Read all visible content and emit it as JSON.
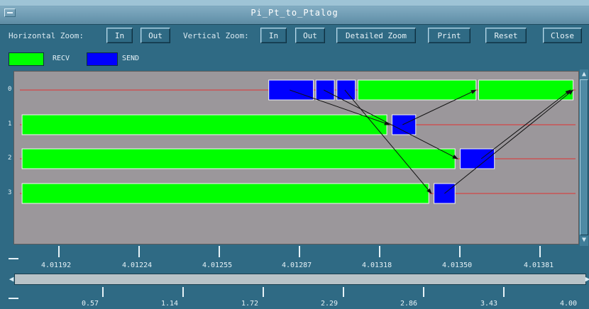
{
  "window": {
    "title": "Pi_Pt_to_Ptalog"
  },
  "toolbar": {
    "horizontal_zoom_label": "Horizontal Zoom:",
    "h_in": "In",
    "h_out": "Out",
    "vertical_zoom_label": "Vertical Zoom:",
    "v_in": "In",
    "v_out": "Out",
    "detailed_zoom": "Detailed Zoom",
    "print": "Print",
    "reset": "Reset",
    "close": "Close"
  },
  "legend": {
    "items": [
      {
        "label": "RECV",
        "color": "#00ff00"
      },
      {
        "label": "SEND",
        "color": "#0000ff"
      }
    ]
  },
  "colors": {
    "recv": "#00ff00",
    "send": "#0000ff",
    "timeline": "#e03030",
    "arrow": "#111111",
    "plot_bg": "#9b979b",
    "frame": "#2f6a84"
  },
  "chart_data": {
    "type": "timeline",
    "rows": [
      "0",
      "1",
      "2",
      "3"
    ],
    "x_unit": "time",
    "x_ticks": [
      "4.01192",
      "4.01224",
      "4.01255",
      "4.01287",
      "4.01318",
      "4.01350",
      "4.01381"
    ],
    "x_tick_values": [
      4.01192,
      4.01224,
      4.01255,
      4.01287,
      4.01318,
      4.0135,
      4.01381
    ],
    "xlim": [
      4.01172,
      4.01387
    ],
    "events": [
      {
        "row": 0,
        "kind": "SEND",
        "start": 4.01269,
        "end": 4.01286
      },
      {
        "row": 0,
        "kind": "SEND",
        "start": 4.01287,
        "end": 4.01294
      },
      {
        "row": 0,
        "kind": "SEND",
        "start": 4.01295,
        "end": 4.01302
      },
      {
        "row": 0,
        "kind": "RECV",
        "start": 4.01303,
        "end": 4.01348
      },
      {
        "row": 0,
        "kind": "RECV",
        "start": 4.01349,
        "end": 4.01385
      },
      {
        "row": 1,
        "kind": "RECV",
        "start": 4.01175,
        "end": 4.01314
      },
      {
        "row": 1,
        "kind": "SEND",
        "start": 4.01316,
        "end": 4.01325
      },
      {
        "row": 2,
        "kind": "RECV",
        "start": 4.01175,
        "end": 4.0134
      },
      {
        "row": 2,
        "kind": "SEND",
        "start": 4.01342,
        "end": 4.01355
      },
      {
        "row": 3,
        "kind": "RECV",
        "start": 4.01175,
        "end": 4.0133
      },
      {
        "row": 3,
        "kind": "SEND",
        "start": 4.01332,
        "end": 4.0134
      }
    ],
    "messages": [
      {
        "from_row": 0,
        "from_t": 4.01277,
        "to_row": 1,
        "to_t": 4.01315
      },
      {
        "from_row": 0,
        "from_t": 4.0129,
        "to_row": 2,
        "to_t": 4.01341
      },
      {
        "from_row": 0,
        "from_t": 4.01298,
        "to_row": 3,
        "to_t": 4.01331
      },
      {
        "from_row": 1,
        "from_t": 4.0132,
        "to_row": 0,
        "to_t": 4.01348
      },
      {
        "from_row": 2,
        "from_t": 4.0135,
        "to_row": 0,
        "to_t": 4.01384
      },
      {
        "from_row": 3,
        "from_t": 4.01336,
        "to_row": 0,
        "to_t": 4.01385
      }
    ]
  },
  "scale2": {
    "ticks": [
      "0.57",
      "1.14",
      "1.72",
      "2.29",
      "2.86",
      "3.43",
      "4.00"
    ]
  }
}
